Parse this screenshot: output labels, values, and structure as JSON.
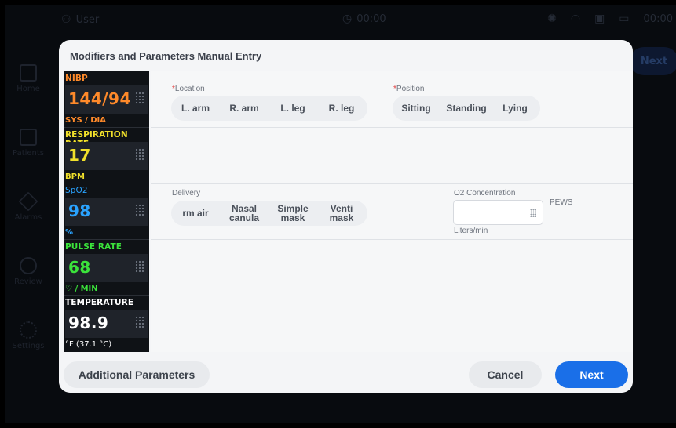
{
  "background": {
    "user_label": "User",
    "clock": "00:00",
    "status_clock": "00:00",
    "next_label": "Next",
    "nav": [
      {
        "label": "Home",
        "icon": "home-icon"
      },
      {
        "label": "Patients",
        "icon": "patients-icon"
      },
      {
        "label": "Alarms",
        "icon": "alarm-icon"
      },
      {
        "label": "Review",
        "icon": "review-icon"
      },
      {
        "label": "Settings",
        "icon": "gear-icon"
      }
    ]
  },
  "modal": {
    "title": "Modifiers and Parameters Manual Entry",
    "vitals": [
      {
        "label": "NIBP",
        "value": "144/94",
        "unit": "SYS / DIA",
        "color": "#ff8a2a"
      },
      {
        "label": "RESPIRATION RATE",
        "value": "17",
        "unit": "BPM",
        "color": "#f1e02b"
      },
      {
        "label": "SpO2",
        "value": "98",
        "unit": "%",
        "color": "#2aa3ff"
      },
      {
        "label": "PULSE RATE",
        "value": "68",
        "unit": "♡ / MIN",
        "color": "#3be33b"
      },
      {
        "label": "TEMPERATURE",
        "value": "98.9",
        "unit": "°F (37.1 °C)",
        "color": "#ffffff"
      }
    ],
    "location": {
      "required_mark": "*",
      "label": "Location",
      "options": [
        "L. arm",
        "R. arm",
        "L. leg",
        "R. leg"
      ]
    },
    "position": {
      "required_mark": "*",
      "label": "Position",
      "options": [
        "Sitting",
        "Standing",
        "Lying"
      ]
    },
    "delivery": {
      "label": "Delivery",
      "options": [
        {
          "line1": "rm air",
          "line2": ""
        },
        {
          "line1": "Nasal",
          "line2": "canula"
        },
        {
          "line1": "Simple",
          "line2": "mask"
        },
        {
          "line1": "Venti",
          "line2": "mask"
        }
      ]
    },
    "o2": {
      "label": "O2 Concentration",
      "value": "",
      "unit": "Liters/min"
    },
    "pews_label": "PEWS",
    "footer": {
      "additional_label": "Additional Parameters",
      "cancel_label": "Cancel",
      "next_label": "Next"
    },
    "colors": {
      "primary": "#1a6fe8",
      "required": "#e23c3c"
    }
  }
}
